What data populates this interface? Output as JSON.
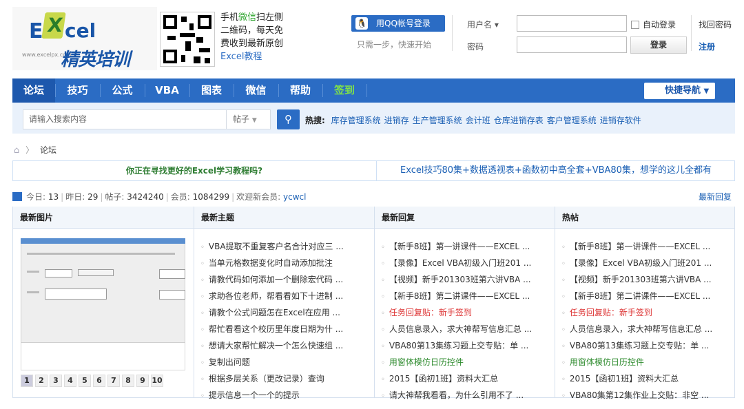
{
  "header": {
    "logo": {
      "brand_e": "E",
      "brand_x": "X",
      "brand_cel": "cel",
      "brand_cn": "精英培训",
      "url": "www.excelpx.com"
    },
    "qr_text": [
      "手机",
      "微信",
      "扫左侧",
      "二维码，每天免",
      "费收到最新原创",
      "Excel教程"
    ],
    "qq_login": "用QQ帐号登录",
    "qq_sub": "只需一步，快速开始",
    "username_label": "用户名 ▾",
    "password_label": "密码",
    "auto_login": "自动登录",
    "forgot": "找回密码",
    "login_button": "登录",
    "register": "注册"
  },
  "nav": {
    "items": [
      "论坛",
      "技巧",
      "公式",
      "VBA",
      "图表",
      "微信",
      "帮助",
      "签到"
    ],
    "quick_nav": "快捷导航"
  },
  "search": {
    "placeholder": "请输入搜索内容",
    "type": "帖子",
    "hot_label": "热搜:",
    "hot_terms": [
      "库存管理系统",
      "进销存",
      "生产管理系统",
      "会计班",
      "仓库进销存表",
      "客户管理系统",
      "进销存软件"
    ]
  },
  "breadcrumb": {
    "current": "论坛"
  },
  "banner": {
    "left": "你正在寻找更好的Excel学习教程吗?",
    "right": "Excel技巧80集+数据透视表+函数初中高全套+VBA80集，想学的这儿全都有"
  },
  "stats": {
    "today_label": "今日:",
    "today": "13",
    "yesterday_label": "昨日:",
    "yesterday": "29",
    "posts_label": "帖子:",
    "posts": "3424240",
    "members_label": "会员:",
    "members": "1084299",
    "welcome_label": "欢迎新会员:",
    "newest": "ycwcl",
    "latest_reply": "最新回复"
  },
  "columns": {
    "images": {
      "title": "最新图片",
      "pages": [
        "1",
        "2",
        "3",
        "4",
        "5",
        "6",
        "7",
        "8",
        "9",
        "10"
      ],
      "active_page": "1"
    },
    "new_topics": {
      "title": "最新主题",
      "items": [
        "VBA提取不重复客户名合计对应三 ...",
        "当单元格数据变化时自动添加批注",
        "请教代码如何添加一个删除宏代码 ...",
        "求助各位老师，帮看看如下十进制 ...",
        "请教个公式问题怎在Excel在应用 ...",
        "帮忙看看这个校历里年度日期为什 ...",
        "想请大家帮忙解决一个怎么快速组 ...",
        "复制出问题",
        "根据多层关系（更改记录）查询",
        "提示信息一个一个的提示"
      ]
    },
    "new_replies": {
      "title": "最新回复",
      "items": [
        {
          "text": "【新手8班】第一讲课件——EXCEL ...",
          "color": "#333333"
        },
        {
          "text": "【录像】Excel VBA初级入门班201 ...",
          "color": "#333333"
        },
        {
          "text": "【视频】新手201303班第六讲VBA ...",
          "color": "#333333"
        },
        {
          "text": "【新手8班】第二讲课件——EXCEL ...",
          "color": "#333333"
        },
        {
          "text": "任务回复贴：新手签到",
          "color": "#dd3333"
        },
        {
          "text": "人员信息录入，求大神帮写信息汇总 ...",
          "color": "#333333"
        },
        {
          "text": "VBA80第13集练习题上交专贴：单 ...",
          "color": "#333333"
        },
        {
          "text": "用窗体模仿日历控件",
          "color": "#2e8b2e"
        },
        {
          "text": "2015【函初1班】资料大汇总",
          "color": "#333333"
        },
        {
          "text": "请大神帮我看看，为什么引用不了 ...",
          "color": "#333333"
        }
      ]
    },
    "hot": {
      "title": "热帖",
      "items": [
        {
          "text": "【新手8班】第一讲课件——EXCEL ...",
          "color": "#333333"
        },
        {
          "text": "【录像】Excel VBA初级入门班201 ...",
          "color": "#333333"
        },
        {
          "text": "【视频】新手201303班第六讲VBA ...",
          "color": "#333333"
        },
        {
          "text": "【新手8班】第二讲课件——EXCEL ...",
          "color": "#333333"
        },
        {
          "text": "任务回复贴：新手签到",
          "color": "#dd3333"
        },
        {
          "text": "人员信息录入，求大神帮写信息汇总 ...",
          "color": "#333333"
        },
        {
          "text": "VBA80第13集练习题上交专贴：单 ...",
          "color": "#333333"
        },
        {
          "text": "用窗体模仿日历控件",
          "color": "#2e8b2e"
        },
        {
          "text": "2015【函初1班】资料大汇总",
          "color": "#333333"
        },
        {
          "text": "VBA80集第12集作业上交贴：非空 ...",
          "color": "#333333"
        }
      ]
    }
  }
}
